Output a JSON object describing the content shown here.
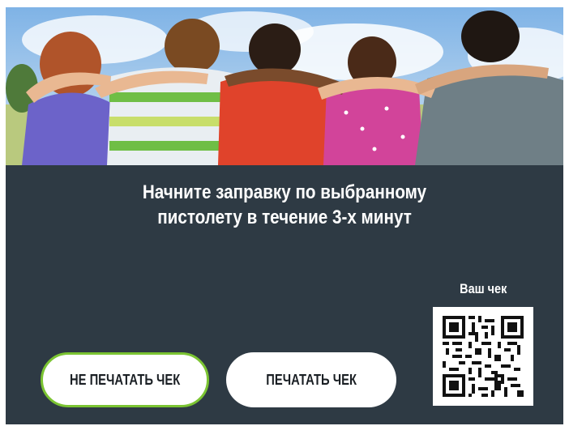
{
  "message": {
    "line1": "Начните заправку по выбранному",
    "line2": "пистолету в течение 3-х минут"
  },
  "buttons": {
    "no_print": "НЕ ПЕЧАТАТЬ ЧЕК",
    "print": "ПЕЧАТАТЬ ЧЕК"
  },
  "receipt": {
    "label": "Ваш чек"
  },
  "colors": {
    "panel": "#2e3a44",
    "accent_border": "#7bc432",
    "button_bg": "#ffffff"
  }
}
